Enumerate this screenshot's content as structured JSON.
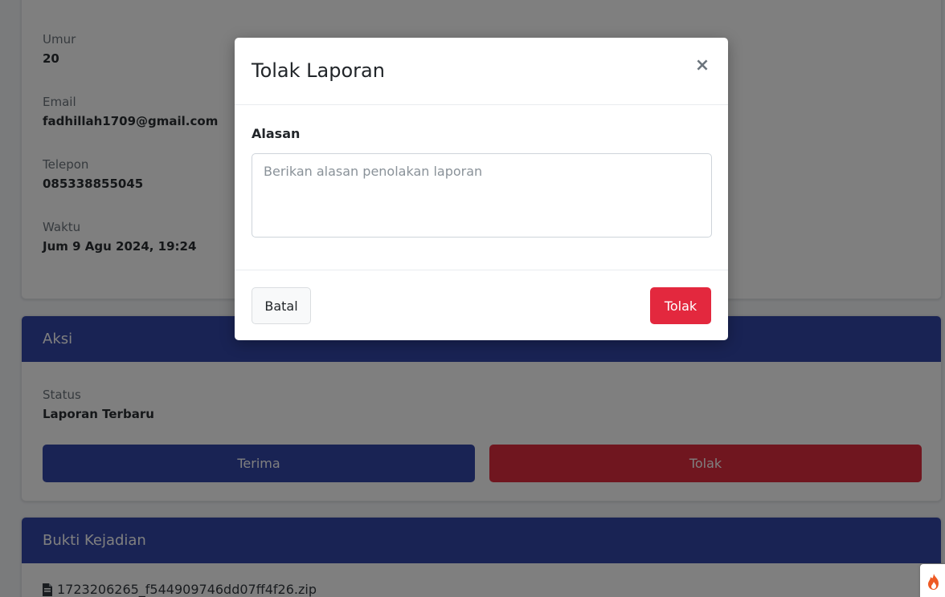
{
  "info": {
    "fields": [
      {
        "label": "Umur",
        "value": "20"
      },
      {
        "label": "Email",
        "value": "fadhillah1709@gmail.com"
      },
      {
        "label": "Telepon",
        "value": "085338855045"
      },
      {
        "label": "Waktu",
        "value": "Jum 9 Agu 2024, 19:24"
      }
    ]
  },
  "aksi": {
    "header": "Aksi",
    "status_label": "Status",
    "status_value": "Laporan Terbaru",
    "accept_label": "Terima",
    "reject_label": "Tolak"
  },
  "bukti": {
    "header": "Bukti Kejadian",
    "file_name": "1723206265_f544909746dd07ff4f26.zip"
  },
  "modal": {
    "title": "Tolak Laporan",
    "close_symbol": "×",
    "reason_label": "Alasan",
    "reason_placeholder": "Berikan alasan penolakan laporan",
    "reason_value": "",
    "cancel_label": "Batal",
    "submit_label": "Tolak"
  },
  "icons": {
    "file": "file-icon",
    "flame": "flame-icon"
  },
  "colors": {
    "primary": "#3346a8",
    "danger": "#e3283e",
    "danger_dark": "#c81f2e"
  }
}
